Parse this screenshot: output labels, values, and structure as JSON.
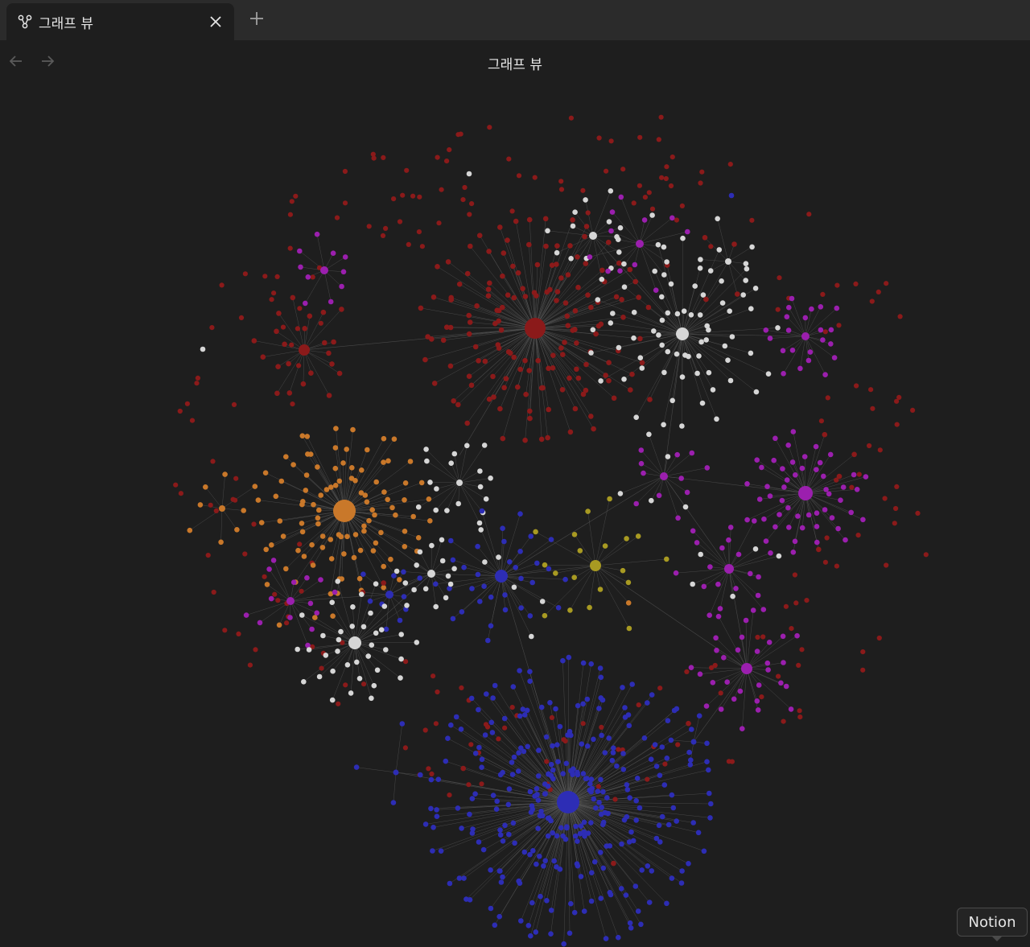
{
  "tab": {
    "title": "그래프 뷰",
    "icon": "graph-icon"
  },
  "toolbar": {
    "close_icon": "close-icon",
    "new_tab_icon": "plus-icon",
    "back_icon": "arrow-left-icon",
    "forward_icon": "arrow-right-icon"
  },
  "view": {
    "title": "그래프 뷰"
  },
  "tooltip": {
    "label": "Notion"
  },
  "colors": {
    "red": "#8b1a1a",
    "purple": "#9b1fae",
    "white": "#d6d6d6",
    "orange": "#c9782a",
    "blue": "#2d2db5",
    "yellow": "#a89a22",
    "edge": "#555555"
  }
}
